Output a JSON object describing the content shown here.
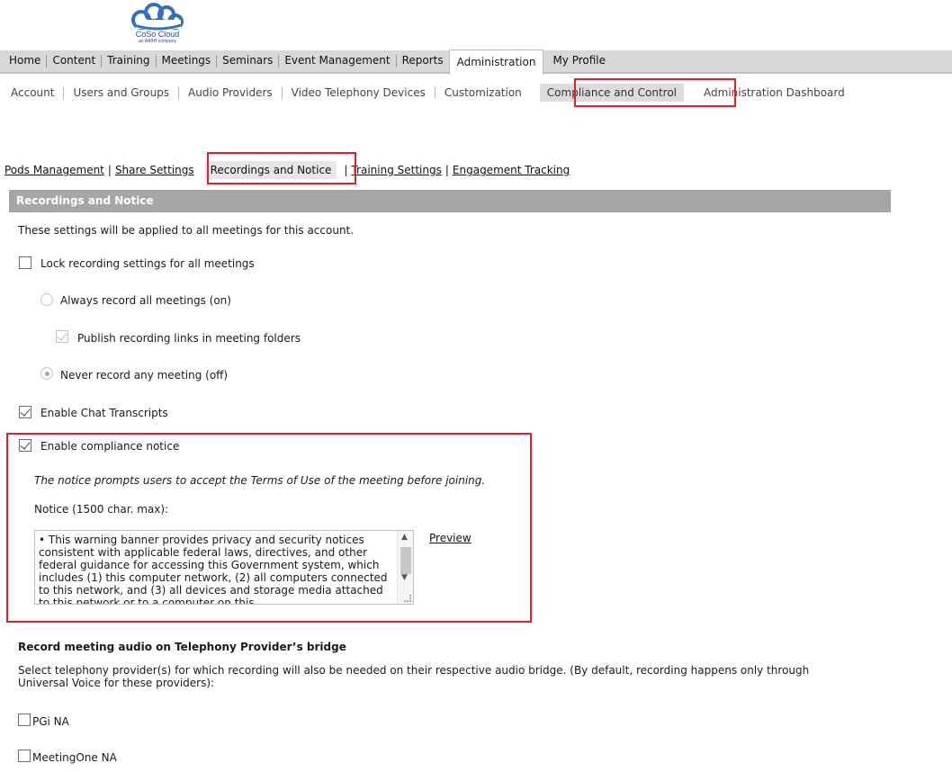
{
  "logo": {
    "name": "CoSo Cloud",
    "sub": "an AABH company"
  },
  "main_nav": {
    "items": [
      "Home",
      "Content",
      "Training",
      "Meetings",
      "Seminars",
      "Event Management",
      "Reports"
    ],
    "active": "Administration",
    "after": "My Profile"
  },
  "sub_nav": {
    "items": [
      "Account",
      "Users and Groups",
      "Audio Providers",
      "Video Telephony Devices",
      "Customization"
    ],
    "active": "Compliance and Control",
    "after": "Administration Dashboard"
  },
  "tabs": {
    "pods": "Pods Management",
    "share": "Share Settings",
    "sep": "|",
    "active": "Recordings and Notice",
    "training": "Training Settings",
    "engagement": "Engagement Tracking"
  },
  "section": {
    "title": "Recordings and Notice",
    "intro": "These settings will be applied to all meetings for this account.",
    "lock_label": "Lock recording settings for all meetings",
    "always_label": "Always record all meetings (on)",
    "publish_label": "Publish recording links in meeting folders",
    "never_label": "Never record any meeting (off)",
    "chat_label": "Enable Chat Transcripts",
    "compliance_label": "Enable compliance notice",
    "compliance_desc": "The notice prompts users to accept the Terms of Use of the meeting before joining.",
    "notice_label": "Notice (1500 char. max):",
    "notice_text": "• This warning banner provides privacy and security notices consistent with applicable federal laws, directives, and other federal guidance for accessing this Government system, which includes (1) this computer network, (2) all computers connected to this network, and (3) all devices and storage media attached to this network or to a computer on this",
    "preview": "Preview",
    "record_heading": "Record meeting audio on Telephony Provider’s bridge",
    "record_desc_1": "Select telephony provider(s) for which recording will also be needed on their respective audio bridge. (By default, recording happens only through",
    "record_desc_2": "Universal Voice for these providers):",
    "providers": [
      "PGi NA",
      "MeetingOne NA"
    ]
  },
  "state": {
    "lock": false,
    "always": false,
    "publish": true,
    "never": true,
    "chat": true,
    "compliance": true,
    "pgi": false,
    "meetingone": false
  },
  "colors": {
    "highlight": "#e0202b",
    "section_bg": "#a6a6a6",
    "nav_bg": "#d8d8d8"
  }
}
